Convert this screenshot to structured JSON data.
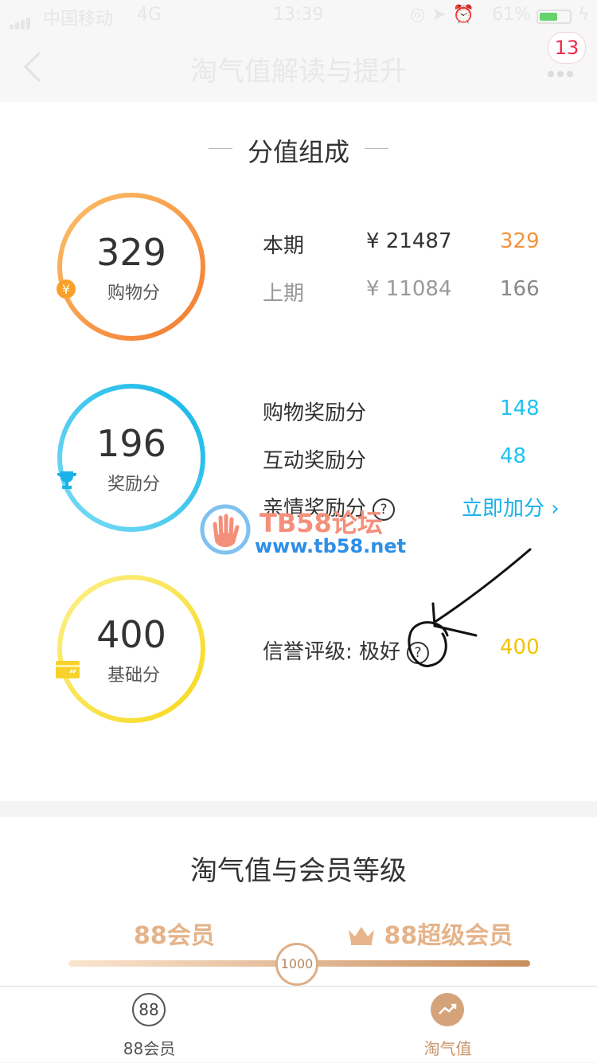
{
  "status_bar": {
    "carrier": "中国移动",
    "network": "4G",
    "time": "13:39",
    "battery": "61%",
    "battery_level": 0.61
  },
  "nav": {
    "title": "淘气值解读与提升",
    "badge_count": "13"
  },
  "composition": {
    "title": "分值组成",
    "shopping": {
      "score": "329",
      "label": "购物分",
      "color": "#f6923a",
      "rows": [
        {
          "period": "本期",
          "amount": "¥ 21487",
          "score": "329"
        },
        {
          "period": "上期",
          "amount": "¥ 11084",
          "score": "166"
        }
      ]
    },
    "reward": {
      "score": "196",
      "label": "奖励分",
      "color": "#1ec3ef",
      "rows": [
        {
          "name": "购物奖励分",
          "score": "148"
        },
        {
          "name": "互动奖励分",
          "score": "48"
        }
      ],
      "family": {
        "name": "亲情奖励分",
        "action": "立即加分"
      }
    },
    "base": {
      "score": "400",
      "label": "基础分",
      "color": "#f6d41c",
      "credit_label": "信誉评级: 极好",
      "credit_score": "400"
    }
  },
  "watermark": {
    "line1": "TB58论坛",
    "line2": "www.tb58.net"
  },
  "membership": {
    "title": "淘气值与会员等级",
    "level_left": "88会员",
    "level_right": "88超级会员",
    "threshold": "1000"
  },
  "tabbar": {
    "tabs": [
      {
        "label": "88会员",
        "icon_text": "88"
      },
      {
        "label": "淘气值"
      }
    ]
  },
  "colors": {
    "accent_orange": "#f6923a",
    "accent_blue": "#1ec3ef",
    "accent_yellow": "#f6d41c",
    "gold": "#e5b389",
    "link_blue": "#1ab2e8"
  }
}
